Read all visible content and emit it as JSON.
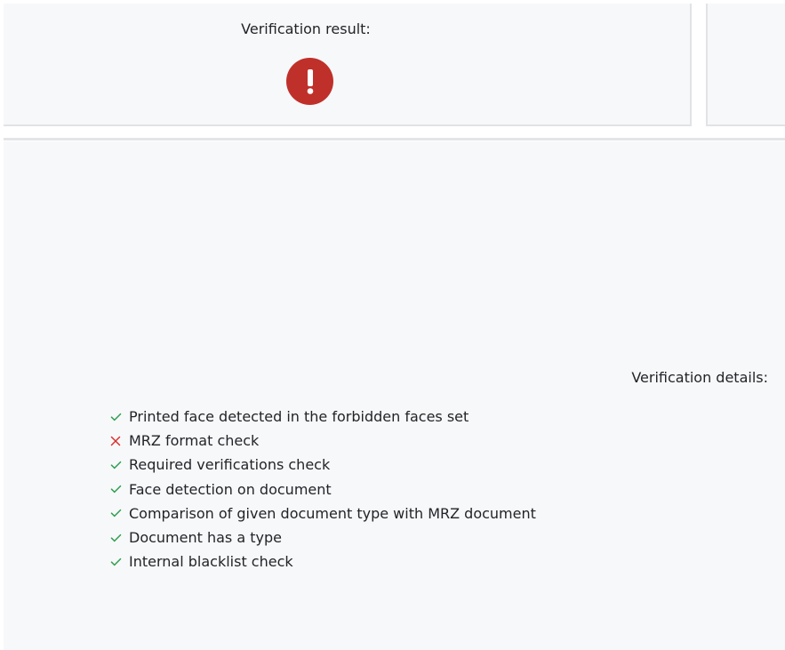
{
  "result": {
    "label": "Verification result:",
    "status": "error",
    "icon": "exclamation-circle-icon",
    "icon_color": "#c0302a"
  },
  "details": {
    "label": "Verification details:",
    "checks": [
      {
        "label": "Printed face detected in the forbidden faces set",
        "passed": true
      },
      {
        "label": "MRZ format check",
        "passed": false
      },
      {
        "label": "Required verifications check",
        "passed": true
      },
      {
        "label": "Face detection on document",
        "passed": true
      },
      {
        "label": "Comparison of given document type with MRZ document",
        "passed": true
      },
      {
        "label": "Document has a type",
        "passed": true
      },
      {
        "label": "Internal blacklist check",
        "passed": true
      }
    ],
    "pass_icon": "check-icon",
    "fail_icon": "cross-icon",
    "pass_color": "#2e9e4f",
    "fail_color": "#d9302c"
  }
}
